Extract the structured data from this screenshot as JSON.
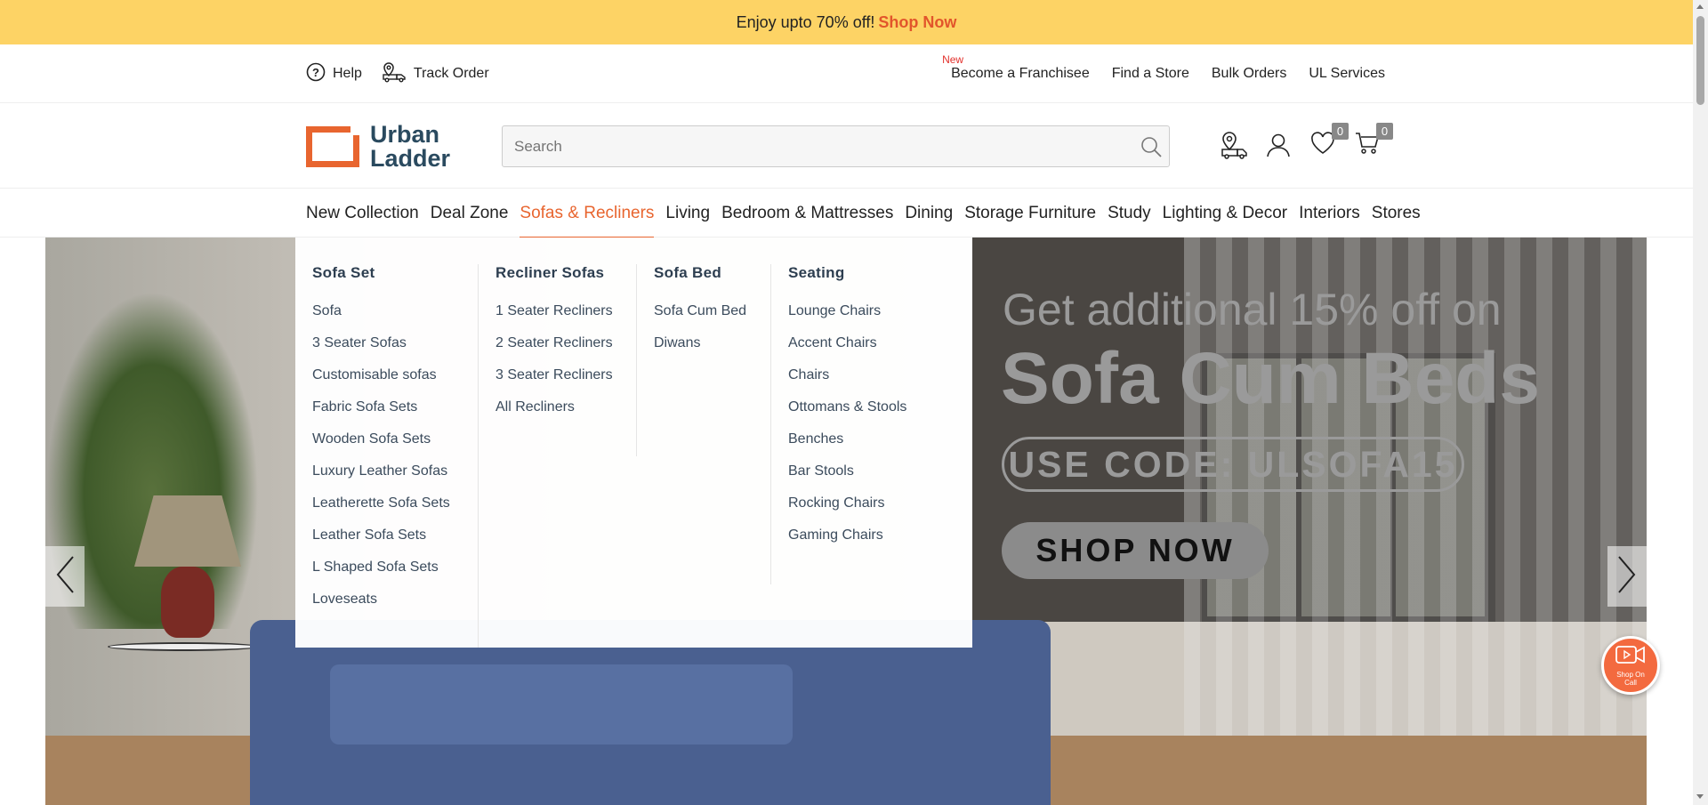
{
  "promo": {
    "text": "Enjoy upto 70% off!",
    "link": "Shop Now"
  },
  "utility": {
    "help": "Help",
    "track_order": "Track Order",
    "new_tag": "New",
    "links": [
      "Become a Franchisee",
      "Find a Store",
      "Bulk Orders",
      "UL Services"
    ]
  },
  "logo": {
    "line1": "Urban",
    "line2": "Ladder"
  },
  "search": {
    "placeholder": "Search",
    "value": ""
  },
  "header_icons": {
    "wishlist_count": "0",
    "cart_count": "0"
  },
  "categories": [
    "New Collection",
    "Deal Zone",
    "Sofas & Recliners",
    "Living",
    "Bedroom & Mattresses",
    "Dining",
    "Storage Furniture",
    "Study",
    "Lighting & Decor",
    "Interiors",
    "Stores"
  ],
  "active_category": "Sofas & Recliners",
  "mega_menu": [
    {
      "title": "Sofa Set",
      "items": [
        "Sofa",
        "3 Seater Sofas",
        "Customisable sofas",
        "Fabric Sofa Sets",
        "Wooden Sofa Sets",
        "Luxury Leather Sofas",
        "Leatherette Sofa Sets",
        "Leather Sofa Sets",
        "L Shaped Sofa Sets",
        "Loveseats"
      ]
    },
    {
      "title": "Recliner Sofas",
      "items": [
        "1 Seater Recliners",
        "2 Seater Recliners",
        "3 Seater Recliners",
        "All Recliners"
      ]
    },
    {
      "title": "Sofa Bed",
      "items": [
        "Sofa Cum Bed",
        "Diwans"
      ]
    },
    {
      "title": "Seating",
      "items": [
        "Lounge Chairs",
        "Accent Chairs",
        "Chairs",
        "Ottomans & Stools",
        "Benches",
        "Bar Stools",
        "Rocking Chairs",
        "Gaming Chairs"
      ]
    }
  ],
  "hero": {
    "line1": "Get additional 15% off on",
    "line2": "Sofa Cum Beds",
    "code": "USE CODE: ULSOFA15",
    "button": "SHOP NOW"
  },
  "fab": {
    "label_line1": "Shop On",
    "label_line2": "Call"
  },
  "colors": {
    "accent": "#e8652f",
    "promo_bg": "#fdd365",
    "brand_text": "#2a4a5f"
  },
  "icons": [
    "help-icon",
    "track-order-icon",
    "search-icon",
    "store-locator-icon",
    "user-icon",
    "heart-icon",
    "cart-icon",
    "chevron-left-icon",
    "chevron-right-icon",
    "video-call-icon"
  ]
}
